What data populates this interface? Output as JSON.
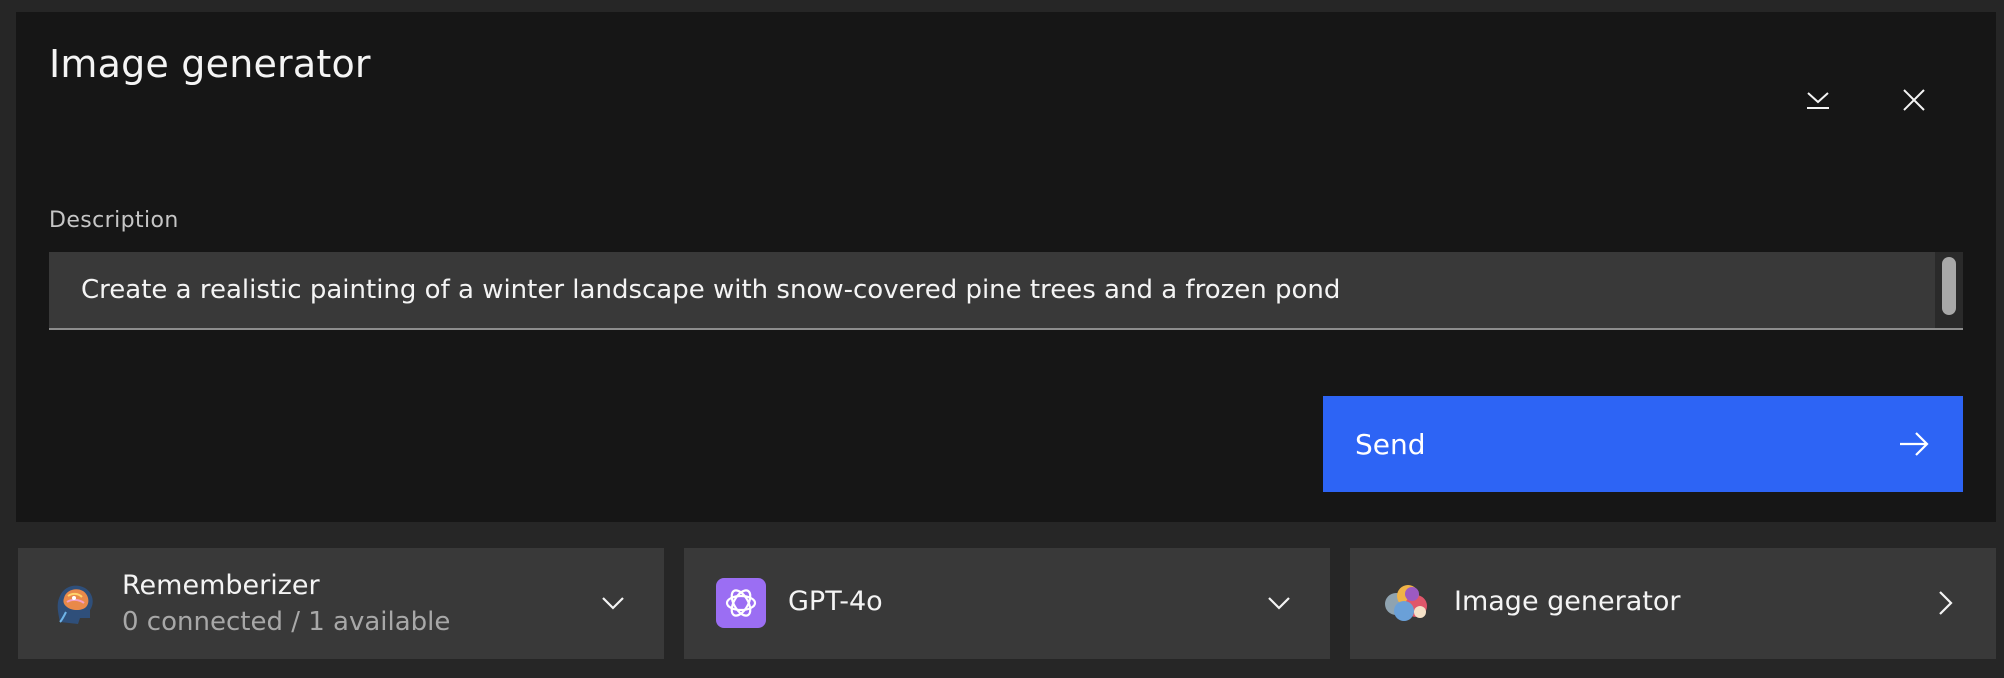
{
  "dialog": {
    "title": "Image generator",
    "minimize_icon": "chevron-down-bar-icon",
    "close_icon": "close-icon"
  },
  "description": {
    "label": "Description",
    "value": "Create a realistic painting of a winter landscape with snow-covered pine trees and a frozen pond"
  },
  "send_button": {
    "label": "Send",
    "icon": "arrow-right-icon",
    "color": "#2d64f5"
  },
  "cards": [
    {
      "name": "Rememberizer",
      "sub": "0 connected / 1 available",
      "icon": "rememberizer-brain-icon",
      "chevron": "chevron-down-icon"
    },
    {
      "name": "GPT-4o",
      "icon": "openai-icon",
      "chevron": "chevron-down-icon"
    },
    {
      "name": "Image generator",
      "icon": "image-generator-palette-icon",
      "chevron": "chevron-right-icon"
    }
  ],
  "colors": {
    "background": "#262626",
    "panel": "#161616",
    "field": "#393939",
    "openai_purple": "#9b6ef3"
  }
}
